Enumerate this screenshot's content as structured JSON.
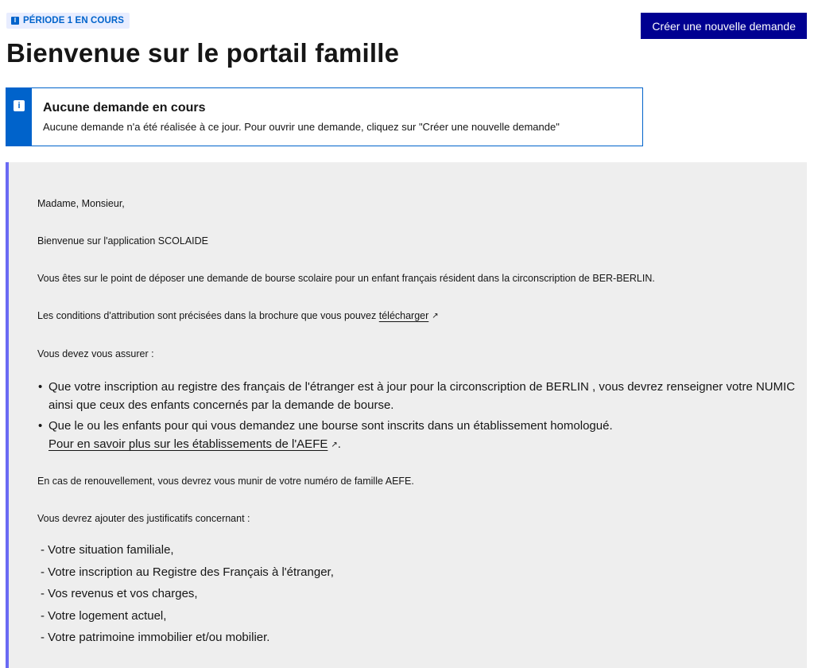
{
  "header": {
    "period_badge": "PÉRIODE 1 EN COURS",
    "create_button_label": "Créer une nouvelle demande",
    "page_title": "Bienvenue sur le portail famille"
  },
  "alert": {
    "title": "Aucune demande en cours",
    "text": "Aucune demande n'a été réalisée à ce jour. Pour ouvrir une demande, cliquez sur \"Créer une nouvelle demande\""
  },
  "info": {
    "greeting": "Madame, Monsieur,",
    "welcome": "Bienvenue sur l'application SCOLAIDE",
    "intro": "Vous êtes sur le point de déposer une demande de bourse scolaire pour un enfant français résident dans la circonscription de BER-BERLIN.",
    "conditions_prefix": "Les conditions d'attribution sont précisées dans la brochure que vous pouvez ",
    "download_link": "télécharger",
    "must_ensure": "Vous devez vous assurer :",
    "bullets": [
      "Que votre inscription au registre des français de l'étranger est à jour pour la circonscription de BERLIN , vous devrez renseigner votre NUMIC ainsi que ceux des enfants concernés par la demande de bourse.",
      "Que le ou les enfants pour qui vous demandez une bourse sont inscrits dans un établissement homologué."
    ],
    "aefe_link": "Pour en savoir plus sur les établissements de l'AEFE",
    "aefe_suffix": ".",
    "renewal": "En cas de renouvellement, vous devrez vous munir de votre numéro de famille AEFE.",
    "justifs_intro": "Vous devrez ajouter des justificatifs concernant :",
    "justifs": [
      "- Votre situation familiale,",
      "- Votre inscription au Registre des Français à l'étranger,",
      "- Vos revenus et vos charges,",
      "- Votre logement actuel,",
      "- Votre patrimoine immobilier et/ou mobilier."
    ]
  },
  "colors": {
    "primary": "#000091",
    "info_blue": "#0063cb",
    "accent_border": "#6a6af4",
    "panel_bg": "#eeeeee"
  },
  "icons": {
    "badge_icon": "info-icon",
    "alert_icon": "info-icon",
    "link_icon": "external-link-icon"
  }
}
